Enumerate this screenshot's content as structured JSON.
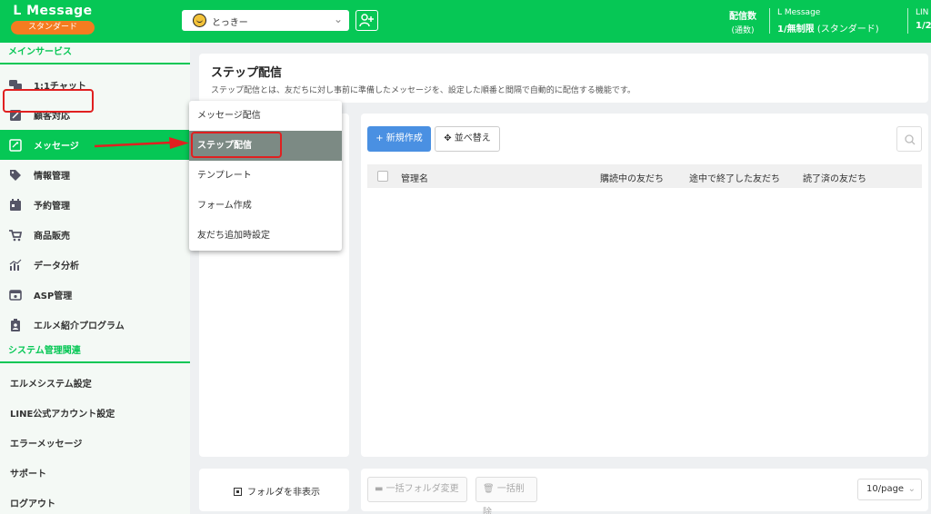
{
  "header": {
    "brand": "L Message",
    "plan_badge": "スタンダード",
    "account_name": "とっきー",
    "delivery_title": "配信数",
    "delivery_sub": "(通数)",
    "plan_title": "L Message",
    "plan_value": "1/無制限",
    "plan_type": "(スタンダード)",
    "line_title": "LIN",
    "line_value": "1/2"
  },
  "sidebar": {
    "section_main": "メインサービス",
    "items": [
      {
        "label": "1:1チャット"
      },
      {
        "label": "顧客対応"
      },
      {
        "label": "メッセージ"
      },
      {
        "label": "情報管理"
      },
      {
        "label": "予約管理"
      },
      {
        "label": "商品販売"
      },
      {
        "label": "データ分析"
      },
      {
        "label": "ASP管理"
      },
      {
        "label": "エルメ紹介プログラム"
      }
    ],
    "section_system": "システム管理関連",
    "system_items": [
      {
        "label": "エルメシステム設定"
      },
      {
        "label": "LINE公式アカウント設定"
      },
      {
        "label": "エラーメッセージ"
      },
      {
        "label": "サポート"
      },
      {
        "label": "ログアウト"
      }
    ]
  },
  "submenu": {
    "items": [
      {
        "label": "メッセージ配信"
      },
      {
        "label": "ステップ配信"
      },
      {
        "label": "テンプレート"
      },
      {
        "label": "フォーム作成"
      },
      {
        "label": "友だち追加時設定"
      }
    ]
  },
  "page": {
    "title": "ステップ配信",
    "description": "ステップ配信とは、友だちに対し事前に準備したメッセージを、設定した順番と間隔で自動的に配信する機能です。"
  },
  "toolbar": {
    "new_label": "+ 新規作成",
    "sort_label": "並べ替え"
  },
  "table": {
    "columns": [
      "管理名",
      "購読中の友だち",
      "途中で終了した友だち",
      "読了済の友だち"
    ]
  },
  "footer": {
    "toggle_folder": "フォルダを非表示",
    "bulk_folder": "一括フォルダ変更",
    "bulk_delete": "一括削除",
    "page_size": "10/page"
  },
  "colors": {
    "brand_green": "#06c755",
    "badge_orange": "#f47c20",
    "primary_blue": "#4a90e2",
    "highlight_red": "#e02020"
  }
}
